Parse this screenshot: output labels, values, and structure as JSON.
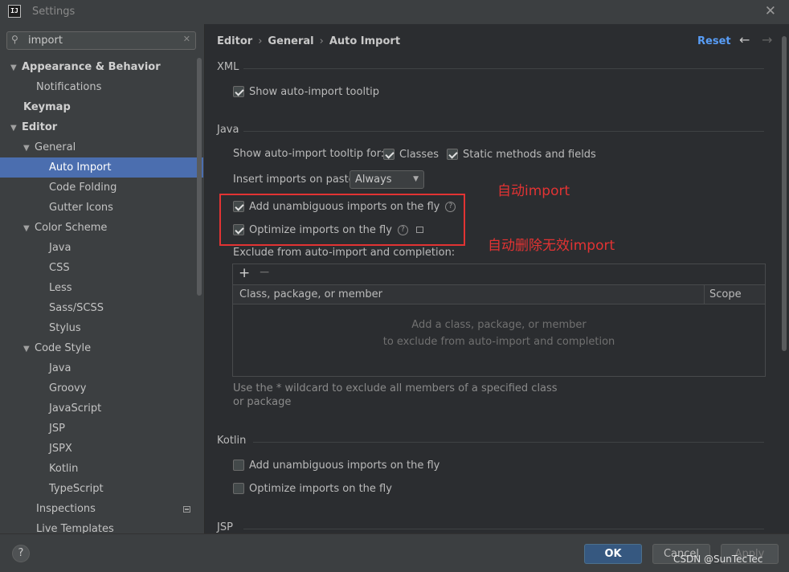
{
  "window": {
    "title": "Settings",
    "app_logo_text": "IJ"
  },
  "search": {
    "value": "import"
  },
  "sidebar": {
    "items": [
      {
        "label": "Appearance & Behavior"
      },
      {
        "label": "Notifications"
      },
      {
        "label": "Keymap"
      },
      {
        "label": "Editor"
      },
      {
        "label": "General"
      },
      {
        "label": "Auto Import"
      },
      {
        "label": "Code Folding"
      },
      {
        "label": "Gutter Icons"
      },
      {
        "label": "Color Scheme"
      },
      {
        "label": "Java"
      },
      {
        "label": "CSS"
      },
      {
        "label": "Less"
      },
      {
        "label": "Sass/SCSS"
      },
      {
        "label": "Stylus"
      },
      {
        "label": "Code Style"
      },
      {
        "label": "Java"
      },
      {
        "label": "Groovy"
      },
      {
        "label": "JavaScript"
      },
      {
        "label": "JSP"
      },
      {
        "label": "JSPX"
      },
      {
        "label": "Kotlin"
      },
      {
        "label": "TypeScript"
      },
      {
        "label": "Inspections"
      },
      {
        "label": "Live Templates"
      }
    ]
  },
  "breadcrumb": {
    "part1": "Editor",
    "part2": "General",
    "part3": "Auto Import",
    "separator": "›"
  },
  "header": {
    "reset_label": "Reset"
  },
  "xml": {
    "title": "XML",
    "show_tooltip": {
      "label": "Show auto-import tooltip",
      "checked": true
    }
  },
  "java": {
    "title": "Java",
    "tooltip_for_label": "Show auto-import tooltip for:",
    "classes": {
      "label": "Classes",
      "checked": true
    },
    "static_methods": {
      "label": "Static methods and fields",
      "checked": true
    },
    "insert_on_paste_label": "Insert imports on paste:",
    "insert_on_paste_value": "Always",
    "add_unambiguous": {
      "label": "Add unambiguous imports on the fly",
      "checked": true
    },
    "optimize_imports": {
      "label": "Optimize imports on the fly",
      "checked": true
    },
    "exclude_label": "Exclude from auto-import and completion:",
    "table": {
      "col_class": "Class, package, or member",
      "col_scope": "Scope",
      "empty_line1": "Add a class, package, or member",
      "empty_line2": "to exclude from auto-import and completion"
    },
    "hint": "Use the * wildcard to exclude all members of a specified class or package"
  },
  "annotations": {
    "auto_import": "自动import",
    "auto_remove": "自动删除无效import"
  },
  "kotlin": {
    "title": "Kotlin",
    "add_unambiguous": {
      "label": "Add unambiguous imports on the fly",
      "checked": false
    },
    "optimize_imports": {
      "label": "Optimize imports on the fly",
      "checked": false
    }
  },
  "jsp": {
    "title": "JSP"
  },
  "footer": {
    "help_label": "?",
    "ok_label": "OK",
    "cancel_label": "Cancel",
    "apply_label": "Apply"
  },
  "watermark": "CSDN @SunTecTec",
  "colors": {
    "accent": "#4b6eaf",
    "link": "#589df6",
    "annotation": "#e23333",
    "ok_button": "#365880"
  }
}
